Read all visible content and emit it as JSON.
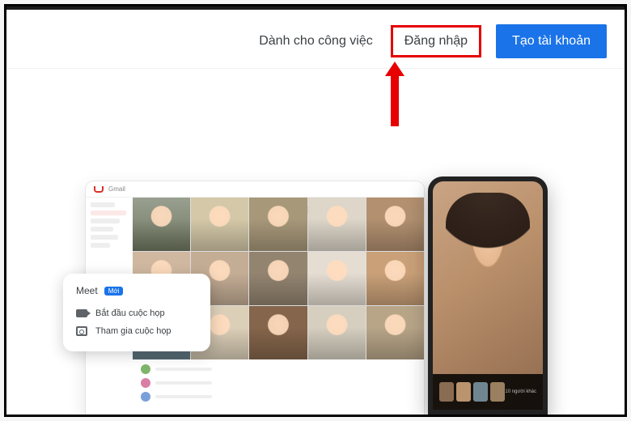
{
  "header": {
    "work_link": "Dành cho công việc",
    "signin_link": "Đăng nhập",
    "create_account_btn": "Tạo tài khoản"
  },
  "meet_popup": {
    "title": "Meet",
    "badge": "Mới",
    "start_meeting": "Bắt đầu cuộc họp",
    "join_meeting": "Tham gia cuộc họp"
  },
  "laptop": {
    "app_label": "Gmail"
  },
  "phone": {
    "participants_label": "10 người khác"
  },
  "colors": {
    "primary": "#1a73e8",
    "highlight": "#e60000"
  }
}
